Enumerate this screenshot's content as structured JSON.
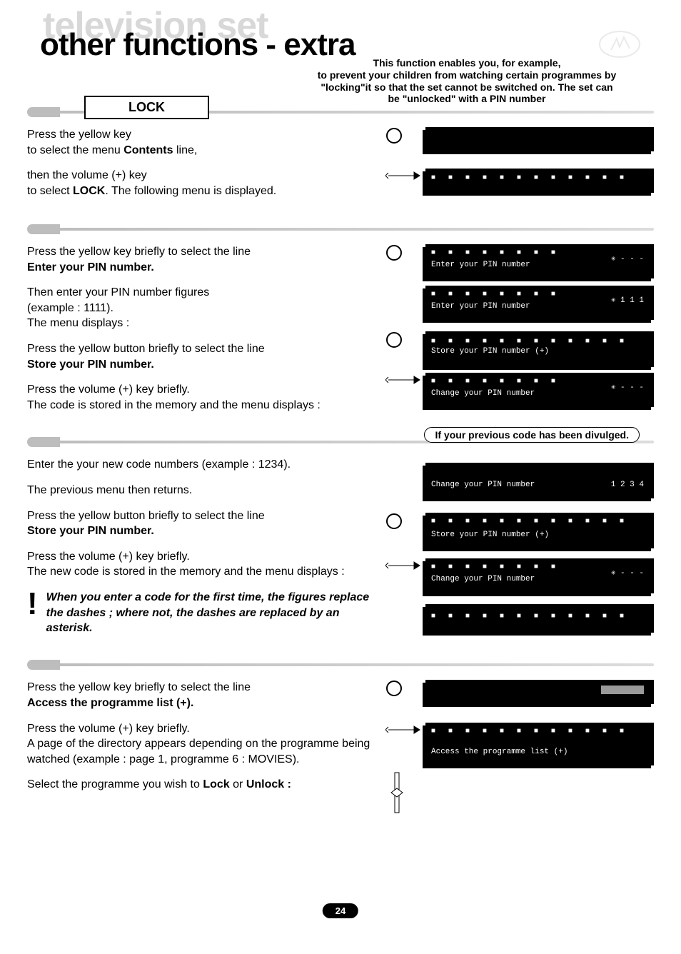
{
  "ghost_title": "television set",
  "main_title": "other functions - extra",
  "intro": "This function enables you, for example,\nto prevent your children from watching certain programmes by\n\"locking\"it so that the set cannot be switched on. The set can\nbe \"unlocked\" with a PIN number",
  "lock_label": "LOCK",
  "page_number": "24",
  "s1": {
    "p1a": "Press the yellow key",
    "p1b": "to select the menu ",
    "p1b_bold": "Contents",
    "p1b_tail": " line,",
    "p2a": "then the volume (+) key",
    "p2b": "to select ",
    "p2b_bold": "LOCK",
    "p2b_tail": ". The following menu is displayed."
  },
  "s2": {
    "p1": "Press the yellow key briefly to select the line",
    "p1_bold": "Enter your PIN number.",
    "p2a": "Then enter your PIN number figures",
    "p2b": "(example : 1111).",
    "p2c": "The menu displays :",
    "p3": "Press the yellow button briefly to select the line",
    "p3_bold": "Store your PIN number.",
    "p4a": "Press the volume (+) key briefly.",
    "p4b": "The code is stored in the memory and the menu displays :",
    "osd_enter": "Enter your PIN number",
    "osd_enter_tail": "✳ - - -",
    "osd_enter2_tail": "✳ 1 1 1",
    "osd_store": "Store your PIN number (+)",
    "osd_change": "Change your PIN number",
    "osd_change_tail": "✳ - - -"
  },
  "s3": {
    "note": "If your previous code has been divulged.",
    "p1": "Enter the your new code numbers (example : 1234).",
    "p2": "The previous menu then returns.",
    "p3": "Press the yellow button briefly to select the line",
    "p3_bold": "Store your PIN number.",
    "p4a": "Press the volume (+) key briefly.",
    "p4b": "The new code is stored in the memory and the menu displays :",
    "tip": "When you enter a code for the first time, the figures replace the dashes ; where not, the dashes are replaced by an asterisk.",
    "osd_change": "Change your PIN number",
    "osd_change_tail": "1 2 3 4",
    "osd_store": "Store your PIN number (+)",
    "osd_change2_tail": "✳ - - -"
  },
  "s4": {
    "p1": "Press the yellow key briefly to select the line",
    "p1_bold": "Access the programme list (+).",
    "p2a": "Press the volume (+) key briefly.",
    "p2b": "A page of the directory appears depending on the programme being watched (example : page 1, programme 6 : MOVIES).",
    "p3a": "Select the programme you wish to ",
    "p3_bold1": "Lock",
    "p3_mid": " or ",
    "p3_bold2": "Unlock :",
    "osd_access": "Access the programme list (+)"
  }
}
